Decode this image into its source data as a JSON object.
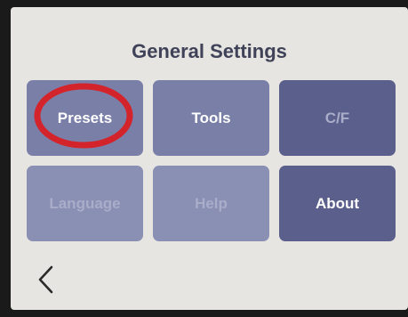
{
  "header": {
    "title": "General Settings"
  },
  "tiles": [
    {
      "label": "Presets",
      "enabled": true
    },
    {
      "label": "Tools",
      "enabled": true
    },
    {
      "label": "C/F",
      "enabled": false
    },
    {
      "label": "Language",
      "enabled": false
    },
    {
      "label": "Help",
      "enabled": false
    },
    {
      "label": "About",
      "enabled": true
    }
  ],
  "navigation": {
    "back_icon": "chevron-left-icon"
  },
  "annotation": {
    "shape": "ellipse",
    "color": "#d4242b",
    "target": "Presets"
  }
}
